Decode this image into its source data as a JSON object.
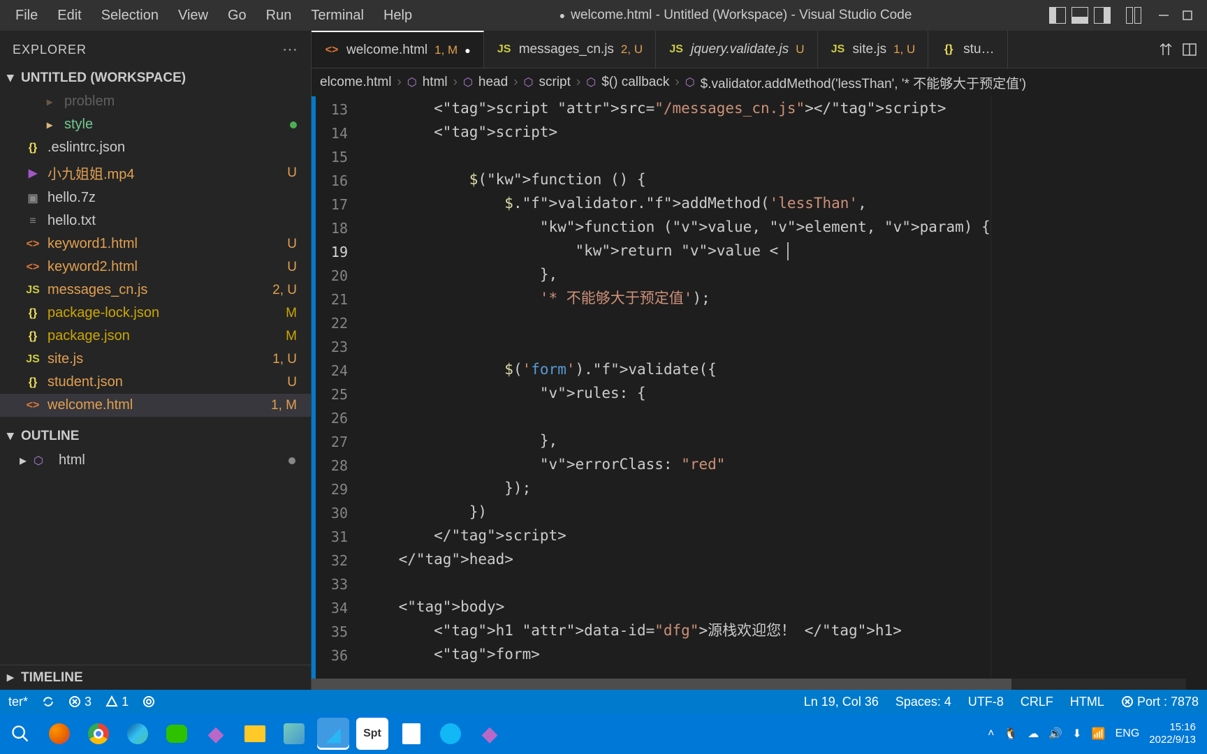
{
  "menu": {
    "file": "File",
    "edit": "Edit",
    "selection": "Selection",
    "view": "View",
    "go": "Go",
    "run": "Run",
    "terminal": "Terminal",
    "help": "Help"
  },
  "title": "welcome.html - Untitled (Workspace) - Visual Studio Code",
  "explorer": {
    "label": "EXPLORER",
    "workspace": "UNTITLED (WORKSPACE)",
    "items": [
      {
        "name": "problem",
        "kind": "folder",
        "indent": 2,
        "dim": true
      },
      {
        "name": "style",
        "kind": "folder",
        "indent": 2,
        "suffix": "",
        "dot": true,
        "green": true
      },
      {
        "name": ".eslintrc.json",
        "kind": "json",
        "indent": 1
      },
      {
        "name": "小九姐姐.mp4",
        "kind": "video",
        "indent": 1,
        "suffix": "U",
        "orange": true
      },
      {
        "name": "hello.7z",
        "kind": "arc",
        "indent": 1
      },
      {
        "name": "hello.txt",
        "kind": "txt",
        "indent": 1
      },
      {
        "name": "keyword1.html",
        "kind": "html",
        "indent": 1,
        "suffix": "U",
        "orange": true
      },
      {
        "name": "keyword2.html",
        "kind": "html",
        "indent": 1,
        "suffix": "U",
        "orange": true
      },
      {
        "name": "messages_cn.js",
        "kind": "js",
        "indent": 1,
        "suffix": "2, U",
        "orange": true
      },
      {
        "name": "package-lock.json",
        "kind": "json",
        "indent": 1,
        "suffix": "M",
        "warn": true
      },
      {
        "name": "package.json",
        "kind": "json",
        "indent": 1,
        "suffix": "M",
        "warn": true
      },
      {
        "name": "site.js",
        "kind": "js",
        "indent": 1,
        "suffix": "1, U",
        "orange": true
      },
      {
        "name": "student.json",
        "kind": "json",
        "indent": 1,
        "suffix": "U",
        "orange": true
      },
      {
        "name": "welcome.html",
        "kind": "html",
        "indent": 1,
        "suffix": "1, M",
        "orange": true,
        "active": true
      }
    ],
    "outline_label": "OUTLINE",
    "outline_item": "html",
    "timeline_label": "TIMELINE"
  },
  "tabs": [
    {
      "label": "welcome.html",
      "icon": "html",
      "suffix": "1, M",
      "suffixClass": "orange",
      "active": true,
      "dirty": true
    },
    {
      "label": "messages_cn.js",
      "icon": "js",
      "suffix": "2, U",
      "suffixClass": "orange"
    },
    {
      "label": "jquery.validate.js",
      "icon": "js",
      "suffix": "U",
      "suffixClass": "orange",
      "italic": true
    },
    {
      "label": "site.js",
      "icon": "js",
      "suffix": "1, U",
      "suffixClass": "orange"
    },
    {
      "label": "stu…",
      "icon": "json"
    }
  ],
  "breadcrumb": {
    "parts": [
      "elcome.html",
      "html",
      "head",
      "script",
      "$() callback",
      "$.validator.addMethod('lessThan', '* 不能够大于预定值')"
    ]
  },
  "code": {
    "start": 13,
    "current": 19,
    "lines": [
      "        <script src=\"/messages_cn.js\"></script>",
      "        <script>",
      "",
      "            $(function () {",
      "                $.validator.addMethod('lessThan',",
      "                    function (value, element, param) {",
      "                        return value < ",
      "                    },",
      "                    '* 不能够大于预定值');",
      "",
      "",
      "                $('form').validate({",
      "                    rules: {",
      "",
      "                    },",
      "                    errorClass: \"red\"",
      "                });",
      "            })",
      "        </script>",
      "    </head>",
      "",
      "    <body>",
      "        <h1 data-id=\"dfg\">源栈欢迎您！ </h1>",
      "        <form>"
    ]
  },
  "status": {
    "branch": "ter*",
    "errors": "3",
    "warnings": "1",
    "cursor": "Ln 19, Col 36",
    "spaces": "Spaces: 4",
    "encoding": "UTF-8",
    "eol": "CRLF",
    "lang": "HTML",
    "port": "Port : 7878"
  },
  "taskbar": {
    "lang": "ENG",
    "time": "15:16",
    "date": "2022/9/13"
  }
}
